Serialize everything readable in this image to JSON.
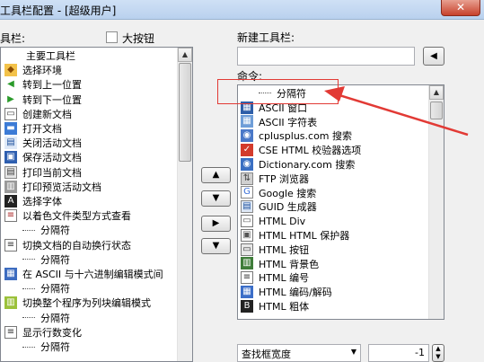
{
  "window": {
    "title": "工具栏配置 - [超级用户]",
    "close_glyph": "✕"
  },
  "left": {
    "label": "具栏:",
    "large_buttons_label": "大按钮",
    "large_buttons_checked": false,
    "items": [
      {
        "label": "主要工具栏",
        "icon": "none",
        "separator": false
      },
      {
        "label": "选择环境",
        "icon": "environment-icon",
        "separator": false
      },
      {
        "label": "转到上一位置",
        "icon": "back-arrow-icon",
        "separator": false
      },
      {
        "label": "转到下一位置",
        "icon": "forward-arrow-icon",
        "separator": false
      },
      {
        "label": "创建新文档",
        "icon": "new-document-icon",
        "separator": false
      },
      {
        "label": "打开文档",
        "icon": "open-folder-icon",
        "separator": false
      },
      {
        "label": "关闭活动文档",
        "icon": "close-document-icon",
        "separator": false
      },
      {
        "label": "保存活动文档",
        "icon": "save-disk-icon",
        "separator": false
      },
      {
        "label": "打印当前文档",
        "icon": "printer-icon",
        "separator": false
      },
      {
        "label": "打印预览活动文档",
        "icon": "print-preview-icon",
        "separator": false
      },
      {
        "label": "选择字体",
        "icon": "font-icon",
        "separator": false
      },
      {
        "label": "以着色文件类型方式查看",
        "icon": "color-view-icon",
        "separator": false
      },
      {
        "label": "分隔符",
        "icon": "none",
        "separator": true
      },
      {
        "label": "切换文档的自动换行状态",
        "icon": "word-wrap-icon",
        "separator": false
      },
      {
        "label": "分隔符",
        "icon": "none",
        "separator": true
      },
      {
        "label": "在 ASCII 与十六进制编辑模式间",
        "icon": "hex-mode-icon",
        "separator": false
      },
      {
        "label": "分隔符",
        "icon": "none",
        "separator": true
      },
      {
        "label": "切换整个程序为列块编辑模式",
        "icon": "column-mode-icon",
        "separator": false
      },
      {
        "label": "分隔符",
        "icon": "none",
        "separator": true
      },
      {
        "label": "显示行数变化",
        "icon": "line-count-icon",
        "separator": false
      },
      {
        "label": "分隔符",
        "icon": "none",
        "separator": true
      }
    ]
  },
  "center_buttons": {
    "up": "▲",
    "down": "▼",
    "add": "▶",
    "down2": "▼"
  },
  "right": {
    "new_toolbar_label": "新建工具栏:",
    "new_toolbar_value": "",
    "new_toolbar_button_glyph": "◀",
    "commands_label": "命令:",
    "commands": [
      {
        "label": "分隔符",
        "icon": "none",
        "separator": true
      },
      {
        "label": "ASCII 窗口",
        "icon": "ascii-window-icon",
        "separator": false
      },
      {
        "label": "ASCII 字符表",
        "icon": "ascii-table-icon",
        "separator": false
      },
      {
        "label": "cplusplus.com 搜索",
        "icon": "search-icon",
        "separator": false
      },
      {
        "label": "CSE HTML 校验器选项",
        "icon": "validator-icon",
        "separator": false
      },
      {
        "label": "Dictionary.com 搜索",
        "icon": "dictionary-icon",
        "separator": false
      },
      {
        "label": "FTP 浏览器",
        "icon": "ftp-icon",
        "separator": false
      },
      {
        "label": "Google 搜索",
        "icon": "google-icon",
        "separator": false
      },
      {
        "label": "GUID 生成器",
        "icon": "guid-icon",
        "separator": false
      },
      {
        "label": "HTML Div",
        "icon": "html-div-icon",
        "separator": false
      },
      {
        "label": "HTML HTML 保护器",
        "icon": "html-protect-icon",
        "separator": false
      },
      {
        "label": "HTML 按钮",
        "icon": "html-button-icon",
        "separator": false
      },
      {
        "label": "HTML 背景色",
        "icon": "html-bgcolor-icon",
        "separator": false
      },
      {
        "label": "HTML 编号",
        "icon": "html-number-icon",
        "separator": false
      },
      {
        "label": "HTML 编码/解码",
        "icon": "html-encode-icon",
        "separator": false
      },
      {
        "label": "HTML 粗体",
        "icon": "html-bold-icon",
        "separator": false
      }
    ],
    "search_width_label": "查找框宽度",
    "spin_value": "-1"
  },
  "colors": {
    "annotation": "#e23a35",
    "dialog": "#f0f0f0"
  }
}
